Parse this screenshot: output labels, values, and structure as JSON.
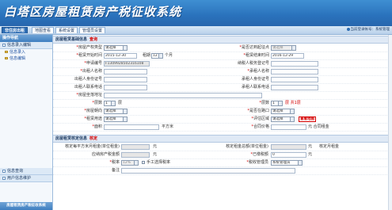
{
  "header": {
    "title": "白塔区房屋租赁房产税征收系统"
  },
  "nav": {
    "tabs": [
      "非住房出租",
      "地图查看",
      "系统设置",
      "管理员设置"
    ],
    "user_label": "当前登录帐号：",
    "user_value": "系统管理"
  },
  "sidebar": {
    "header": "操作导航",
    "group1": "信息录入编辑",
    "items": [
      "信息录入",
      "信息编辑"
    ],
    "group2": "信息查询",
    "group3": "用户信息维护",
    "footer": "房屋租赁房产税征收系统"
  },
  "form": {
    "section1_title": "房屋租赁基础信息",
    "section1_btn": "查询",
    "r1": {
      "l1": "房屋产权类型",
      "v1": "请选择",
      "l2": "是否达到起征点",
      "v2": "请选择"
    },
    "r2": {
      "l1": "租赁开始时间",
      "v1": "2015-12-30",
      "mid1": "租期",
      "v_period": "12",
      "mid2": "个月",
      "l2": "租赁结束时间",
      "v2": "2016-12-29"
    },
    "r3": {
      "l1": "申请编号",
      "v1": "F1309928502316108",
      "l2": "纳税人税务登记号"
    },
    "r4": {
      "l1": "出租人名称",
      "l2": "承租人名称"
    },
    "r5": {
      "l1": "出租人身份证号",
      "l2": "承租人身份证号"
    },
    "r6": {
      "l1": "出租人联系电话",
      "l2": "承租人联系电话"
    },
    "r7": {
      "l1": "房屋坐落地址"
    },
    "r8": {
      "l1": "层数",
      "v1": "1",
      "u1": "层",
      "l2": "层数",
      "v2": "1",
      "u2": "层 共1层"
    },
    "r9": {
      "l1": "房屋朝向",
      "v1": "请选择",
      "l2": "是否在路口",
      "v2": "请选择"
    },
    "r10": {
      "l1": "租赁用途",
      "v1": "请选择",
      "l2": "评估区域",
      "v2": "请选择",
      "btn": "查看地图"
    },
    "r11": {
      "l1": "面积",
      "u1": "平方米",
      "l2": "合同价格",
      "u2": "元 合同租金"
    },
    "section2_title": "房屋租赁核定信息",
    "section2_btn": "核定",
    "s2r1": {
      "l1": "核定每平方米月租金(单位租金)",
      "u1": "元",
      "l2": "核定租金总额(单位租金)",
      "u2": "元",
      "l3": "核定月租金"
    },
    "s2r2": {
      "l1": "应纳房产税金额",
      "u1": "元",
      "l2": "已缴税额",
      "v2": "0",
      "u2": "元"
    },
    "s2r3": {
      "l1": "税率",
      "v1": "12%",
      "l_chk": "手工选择税率",
      "l2": "税收管理员",
      "v2": "系统管理员"
    },
    "s2r4": {
      "l1": "备注"
    }
  }
}
